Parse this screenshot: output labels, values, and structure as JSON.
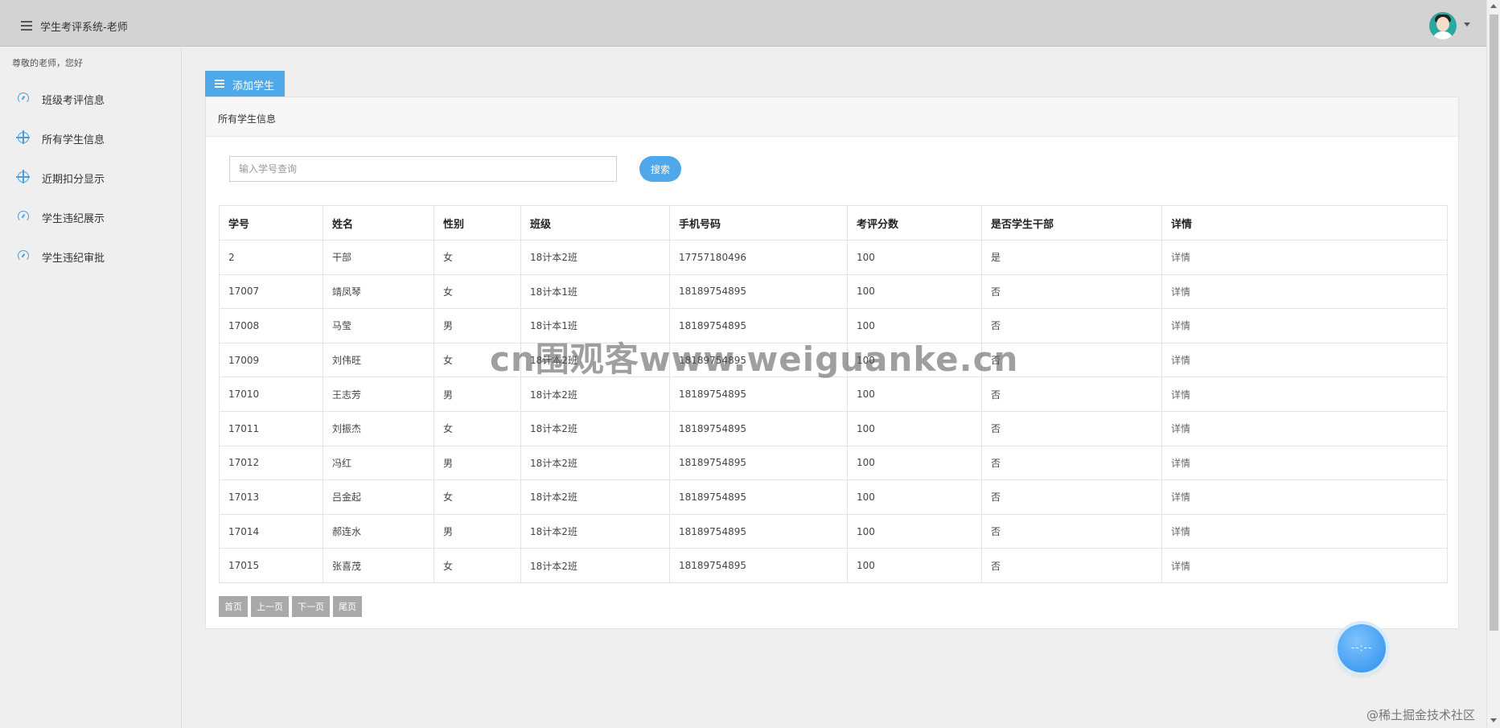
{
  "header": {
    "title": "学生考评系统-老师"
  },
  "sidebar": {
    "greeting": "尊敬的老师，您好",
    "items": [
      {
        "label": "班级考评信息",
        "icon": "gauge-icon"
      },
      {
        "label": "所有学生信息",
        "icon": "crosshair-icon"
      },
      {
        "label": "近期扣分显示",
        "icon": "crosshair-icon"
      },
      {
        "label": "学生违纪展示",
        "icon": "gauge-icon"
      },
      {
        "label": "学生违纪审批",
        "icon": "gauge-icon"
      }
    ]
  },
  "main": {
    "add_button_label": "添加学生",
    "panel_title": "所有学生信息",
    "search": {
      "placeholder": "输入学号查询",
      "value": "",
      "button_label": "搜索"
    },
    "table": {
      "columns": [
        "学号",
        "姓名",
        "性别",
        "班级",
        "手机号码",
        "考评分数",
        "是否学生干部",
        "详情"
      ],
      "rows": [
        [
          "2",
          "干部",
          "女",
          "18计本2班",
          "17757180496",
          "100",
          "是",
          "详情"
        ],
        [
          "17007",
          "靖凤琴",
          "女",
          "18计本1班",
          "18189754895",
          "100",
          "否",
          "详情"
        ],
        [
          "17008",
          "马莹",
          "男",
          "18计本1班",
          "18189754895",
          "100",
          "否",
          "详情"
        ],
        [
          "17009",
          "刘伟旺",
          "女",
          "18计本2班",
          "18189754895",
          "100",
          "否",
          "详情"
        ],
        [
          "17010",
          "王志芳",
          "男",
          "18计本2班",
          "18189754895",
          "100",
          "否",
          "详情"
        ],
        [
          "17011",
          "刘振杰",
          "女",
          "18计本2班",
          "18189754895",
          "100",
          "否",
          "详情"
        ],
        [
          "17012",
          "冯红",
          "男",
          "18计本2班",
          "18189754895",
          "100",
          "否",
          "详情"
        ],
        [
          "17013",
          "吕金起",
          "女",
          "18计本2班",
          "18189754895",
          "100",
          "否",
          "详情"
        ],
        [
          "17014",
          "郝连水",
          "男",
          "18计本2班",
          "18189754895",
          "100",
          "否",
          "详情"
        ],
        [
          "17015",
          "张喜茂",
          "女",
          "18计本2班",
          "18189754895",
          "100",
          "否",
          "详情"
        ]
      ]
    },
    "pager": {
      "first": "首页",
      "prev": "上一页",
      "next": "下一页",
      "last": "尾页"
    }
  },
  "float_widget": {
    "label": "--:--"
  },
  "watermark": "cn围观客www.weiguanke.cn",
  "footer_watermark": "@稀土掘金技术社区",
  "colors": {
    "accent": "#4ea8ea",
    "topbar": "#d3d3d3",
    "pager": "#a9a9a9"
  }
}
